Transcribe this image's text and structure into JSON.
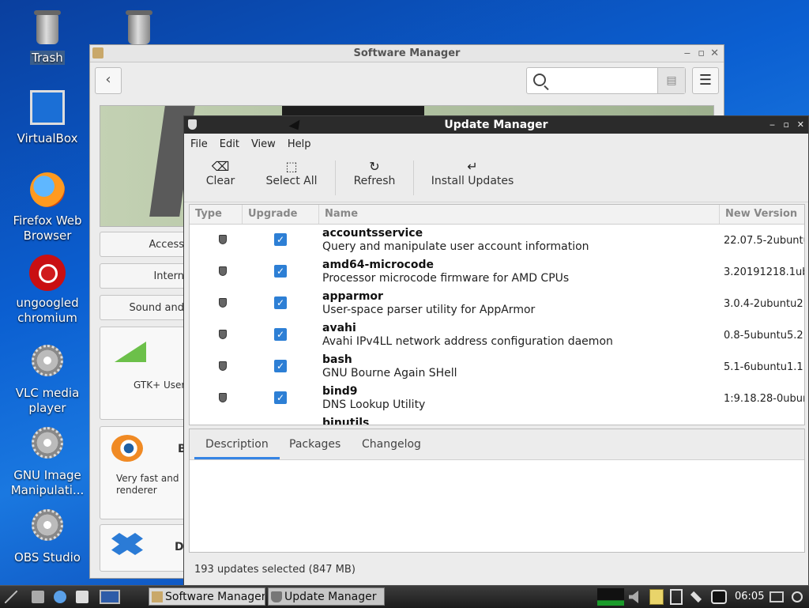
{
  "desktop": {
    "icons": [
      {
        "label": "Trash"
      },
      {
        "label": "VirtualBox"
      },
      {
        "label": "Firefox Web Browser"
      },
      {
        "label": "ungoogled chromium"
      },
      {
        "label": "VLC media player"
      },
      {
        "label": "GNU Image Manipulati..."
      },
      {
        "label": "OBS Studio"
      }
    ]
  },
  "software_manager": {
    "title": "Software Manager",
    "categories": [
      "Access",
      "Intern",
      "Sound and"
    ],
    "cards": [
      {
        "text": "GTK+ User"
      },
      {
        "title": "B",
        "text": "Very fast and renderer"
      },
      {
        "title": "D"
      }
    ]
  },
  "update_manager": {
    "title": "Update Manager",
    "menu": [
      "File",
      "Edit",
      "View",
      "Help"
    ],
    "toolbar": {
      "clear": "Clear",
      "select_all": "Select All",
      "refresh": "Refresh",
      "install": "Install Updates"
    },
    "columns": {
      "type": "Type",
      "upgrade": "Upgrade",
      "name": "Name",
      "version": "New Version"
    },
    "rows": [
      {
        "name": "accountsservice",
        "desc": "Query and manipulate user account information",
        "version": "22.07.5-2ubuntu"
      },
      {
        "name": "amd64-microcode",
        "desc": "Processor microcode firmware for AMD CPUs",
        "version": "3.20191218.1ub"
      },
      {
        "name": "apparmor",
        "desc": "User-space parser utility for AppArmor",
        "version": "3.0.4-2ubuntu2."
      },
      {
        "name": "avahi",
        "desc": "Avahi IPv4LL network address configuration daemon",
        "version": "0.8-5ubuntu5.2"
      },
      {
        "name": "bash",
        "desc": "GNU Bourne Again SHell",
        "version": "5.1-6ubuntu1.1"
      },
      {
        "name": "bind9",
        "desc": "DNS Lookup Utility",
        "version": "1:9.18.28-0ubun"
      },
      {
        "name": "binutils",
        "desc": "",
        "version": ""
      }
    ],
    "tabs": [
      "Description",
      "Packages",
      "Changelog"
    ],
    "status": "193 updates selected (847 MB)"
  },
  "taskbar": {
    "tasks": [
      "Software Manager",
      "Update Manager"
    ],
    "clock": "06:05"
  }
}
